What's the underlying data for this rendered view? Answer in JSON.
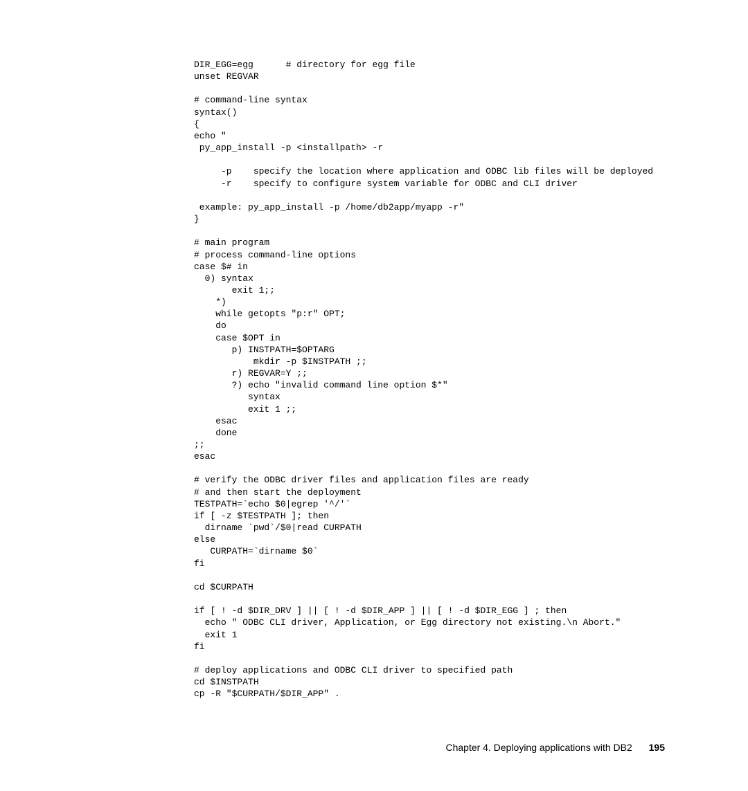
{
  "code": "DIR_EGG=egg      # directory for egg file\nunset REGVAR\n\n# command-line syntax\nsyntax()\n{\necho \"\n py_app_install -p <installpath> -r\n\n     -p    specify the location where application and ODBC lib files will be deployed\n     -r    specify to configure system variable for ODBC and CLI driver\n\n example: py_app_install -p /home/db2app/myapp -r\"\n}\n\n# main program\n# process command-line options\ncase $# in\n  0) syntax\n       exit 1;;\n    *)\n    while getopts \"p:r\" OPT;\n    do\n    case $OPT in\n       p) INSTPATH=$OPTARG\n           mkdir -p $INSTPATH ;;\n       r) REGVAR=Y ;;\n       ?) echo \"invalid command line option $*\"\n          syntax\n          exit 1 ;;\n    esac\n    done\n;;\nesac\n\n# verify the ODBC driver files and application files are ready\n# and then start the deployment\nTESTPATH=`echo $0|egrep '^/'`\nif [ -z $TESTPATH ]; then\n  dirname `pwd`/$0|read CURPATH\nelse\n   CURPATH=`dirname $0`\nfi\n\ncd $CURPATH\n\nif [ ! -d $DIR_DRV ] || [ ! -d $DIR_APP ] || [ ! -d $DIR_EGG ] ; then\n  echo \" ODBC CLI driver, Application, or Egg directory not existing.\\n Abort.\"\n  exit 1\nfi\n\n# deploy applications and ODBC CLI driver to specified path\ncd $INSTPATH\ncp -R \"$CURPATH/$DIR_APP\" .",
  "footer": {
    "chapter": "Chapter 4. Deploying applications with DB2",
    "page": "195"
  }
}
